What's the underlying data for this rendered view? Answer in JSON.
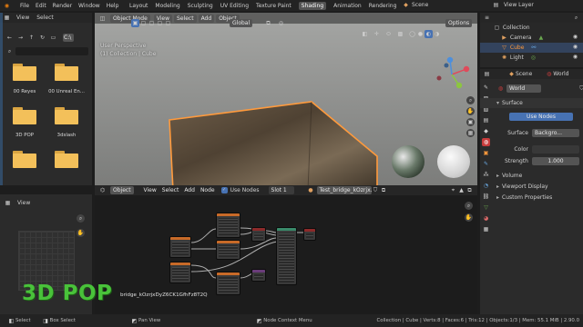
{
  "topbar": {
    "menus": [
      "File",
      "Edit",
      "Render",
      "Window",
      "Help"
    ],
    "workspaces": [
      "Layout",
      "Modeling",
      "Sculpting",
      "UV Editing",
      "Texture Paint",
      "Shading",
      "Animation",
      "Rendering"
    ],
    "active_workspace": "Shading",
    "scene": "Scene",
    "view_layer": "View Layer"
  },
  "file_browser": {
    "menus": [
      "View",
      "Select"
    ],
    "path": "C:\\",
    "folders": [
      "00 Reyes",
      "00 Unreal En...",
      "3D POP",
      "3dslash",
      "",
      "",
      ""
    ],
    "view_menu": "View"
  },
  "viewport": {
    "mode": "Object Mode",
    "menus": [
      "View",
      "Select",
      "Add",
      "Object"
    ],
    "transform": "Global",
    "options": "Options",
    "overlay_title": "User Perspective",
    "overlay_collection": "(1) Collection | Cube"
  },
  "node_editor": {
    "object": "Object",
    "menus": [
      "View",
      "Select",
      "Add",
      "Node"
    ],
    "use_nodes_label": "Use Nodes",
    "use_nodes": true,
    "slot": "Slot 1",
    "material": "Test_bridge_kOzrjx...",
    "texture_label": "bridge_kOzrjxDyZ6CK1GfhFz8T2Q"
  },
  "outliner": {
    "items": [
      {
        "name": "Collection",
        "color": "#e6e6e6"
      },
      {
        "name": "Camera",
        "color": "#e0a060"
      },
      {
        "name": "Cube",
        "color": "#ff9a3c",
        "selected": true
      },
      {
        "name": "Light",
        "color": "#e0a060"
      }
    ]
  },
  "properties": {
    "scene": "Scene",
    "world": "World",
    "surface_panel": "Surface",
    "use_nodes_btn": "Use Nodes",
    "surface_label": "Surface",
    "surface_value": "Backgro...",
    "color_label": "Color",
    "strength_label": "Strength",
    "strength_value": "1.000",
    "panels": [
      "Volume",
      "Viewport Display",
      "Custom Properties"
    ]
  },
  "statusbar": {
    "left": [
      "Select",
      "Box Select",
      "Pan View",
      "Node Context Menu"
    ],
    "right": "Collection | Cube | Verts:8 | Faces:6 | Tris:12 | Objects:1/3 | Mem: 55.1 MiB | 2.90.0"
  },
  "watermark": "3D POP",
  "colors": {
    "accent": "#4772b3",
    "selection": "#ff9a3c",
    "panel": "#303030"
  }
}
